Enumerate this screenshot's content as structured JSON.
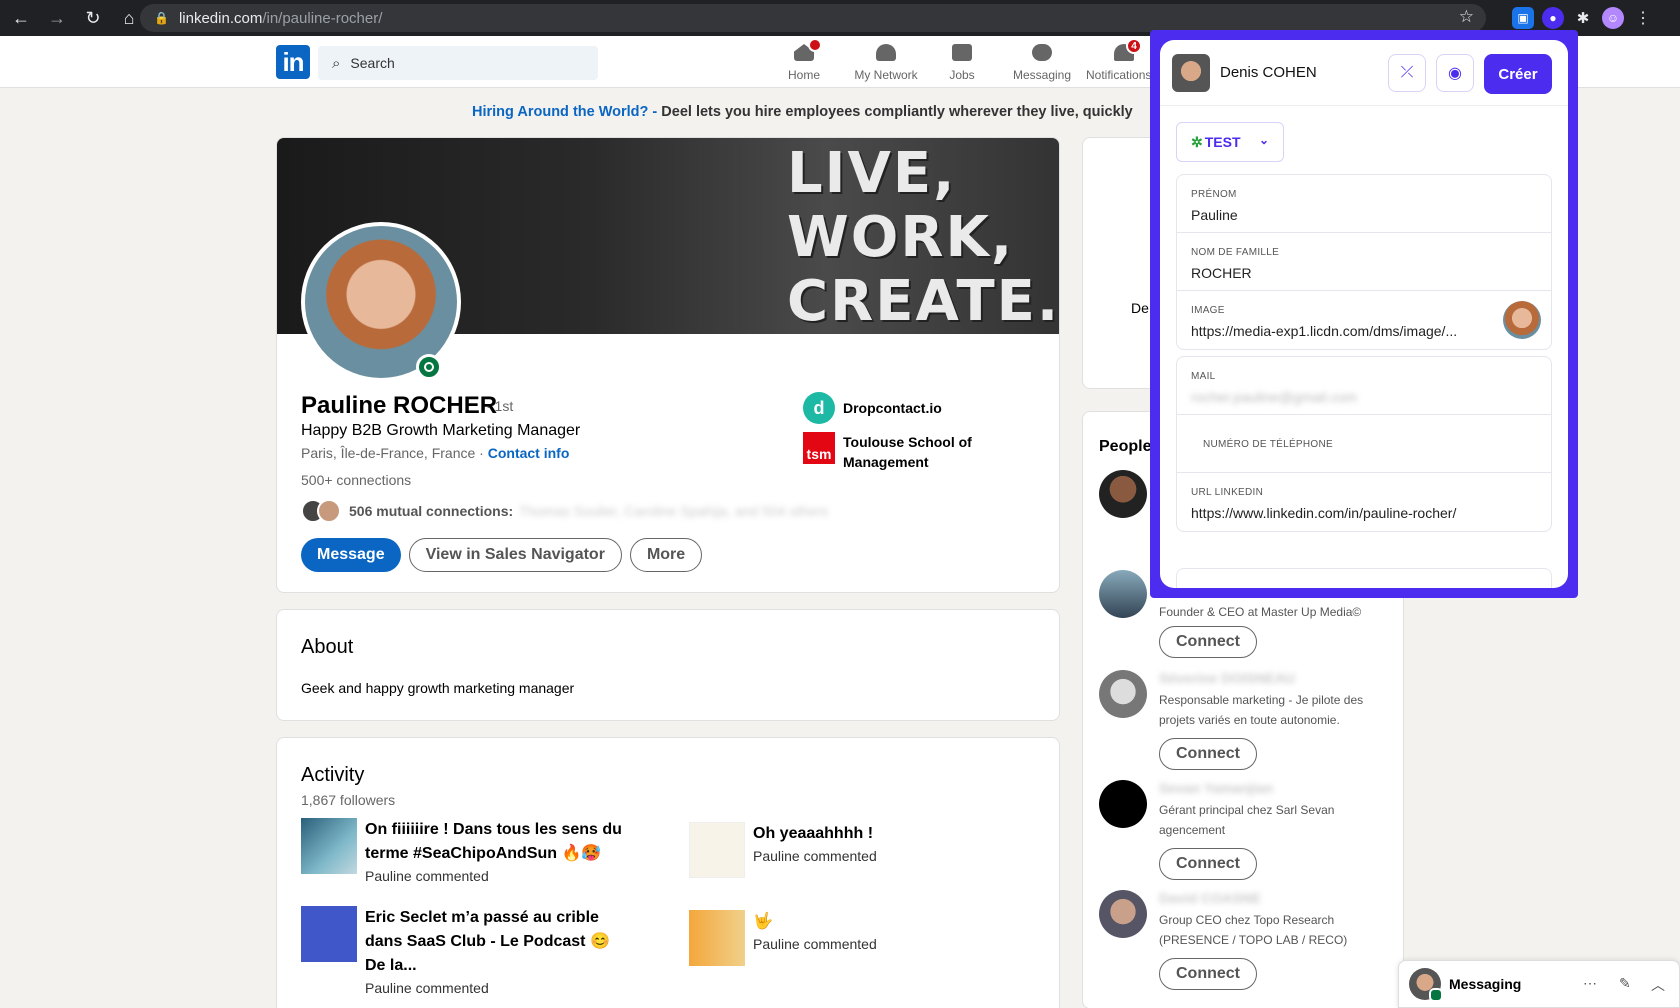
{
  "browser": {
    "url_host": "linkedin.com",
    "url_path": "/in/pauline-rocher/"
  },
  "header": {
    "search_placeholder": "Search",
    "nav": [
      {
        "label": "Home",
        "badge": ""
      },
      {
        "label": "My Network",
        "badge": ""
      },
      {
        "label": "Jobs",
        "badge": ""
      },
      {
        "label": "Messaging",
        "badge": ""
      },
      {
        "label": "Notifications",
        "badge": "4"
      }
    ]
  },
  "promo": {
    "highlight": "Hiring Around the World? -",
    "text": " Deel lets you hire employees compliantly wherever they live, quickly"
  },
  "profile": {
    "banner_text": [
      "LIVE,",
      "WORK,",
      "CREATE."
    ],
    "name": "Pauline ROCHER",
    "degree": "· 1st",
    "headline": "Happy B2B Growth Marketing Manager",
    "location": "Paris, Île-de-France, France ·",
    "contact_info": "Contact info",
    "connections": "500+ connections",
    "mutual_label": "506 mutual connections:",
    "mutual_names": "Thomas Soulier, Caroline Spahija, and 504 others",
    "buttons": {
      "message": "Message",
      "sales_navigator": "View in Sales Navigator",
      "more": "More"
    },
    "companies": [
      {
        "name": "Dropcontact.io",
        "logo_color": "#1db9a5"
      },
      {
        "name": "Toulouse School of Management",
        "logo_color": "#e30613",
        "logo_text": "tsm"
      }
    ]
  },
  "about": {
    "title": "About",
    "text": "Geek and happy growth marketing manager"
  },
  "activity": {
    "title": "Activity",
    "followers": "1,867 followers",
    "items": [
      {
        "title": "On fiiiiiire ! Dans tous les sens du terme #SeaChipoAndSun 🔥🥵",
        "sub": "Pauline commented"
      },
      {
        "title": "Oh yeaaahhhh !",
        "sub": "Pauline commented"
      },
      {
        "title": "Eric Seclet m’a passé au crible dans SaaS Club - Le Podcast 😊 De la...",
        "sub": "Pauline commented"
      },
      {
        "title": "🤟",
        "sub": "Pauline commented"
      }
    ]
  },
  "sidebar": {
    "fragment": "De",
    "people_title": "People",
    "people": [
      {
        "name": "",
        "desc": "",
        "connect": ""
      },
      {
        "name": "",
        "desc": "Founder & CEO at Master Up Media©",
        "connect": "Connect"
      },
      {
        "name": "Séverine DOISNEAU",
        "desc": "Responsable marketing - Je pilote des projets variés en toute autonomie.",
        "connect": "Connect"
      },
      {
        "name": "Sevan Yamanjian",
        "desc": "Gérant principal chez Sarl Sevan agencement",
        "connect": "Connect"
      },
      {
        "name": "David COASNE",
        "desc": "Group CEO chez Topo Research (PRESENCE / TOPO LAB / RECO)",
        "connect": "Connect"
      }
    ]
  },
  "extension": {
    "user": "Denis COHEN",
    "create": "Créer",
    "tag": "TEST",
    "fields": [
      {
        "label": "PRÉNOM",
        "value": "Pauline"
      },
      {
        "label": "NOM DE FAMILLE",
        "value": "ROCHER"
      },
      {
        "label": "IMAGE",
        "value": "https://media-exp1.licdn.com/dms/image/..."
      }
    ],
    "fields2": [
      {
        "label": "MAIL",
        "value": "rocher.pauline@gmail.com"
      },
      {
        "label": "NUMÉRO DE TÉLÉPHONE",
        "value": ""
      },
      {
        "label": "URL LINKEDIN",
        "value": "https://www.linkedin.com/in/pauline-rocher/"
      }
    ],
    "accent": "#4c2df0"
  },
  "messaging": {
    "label": "Messaging"
  }
}
